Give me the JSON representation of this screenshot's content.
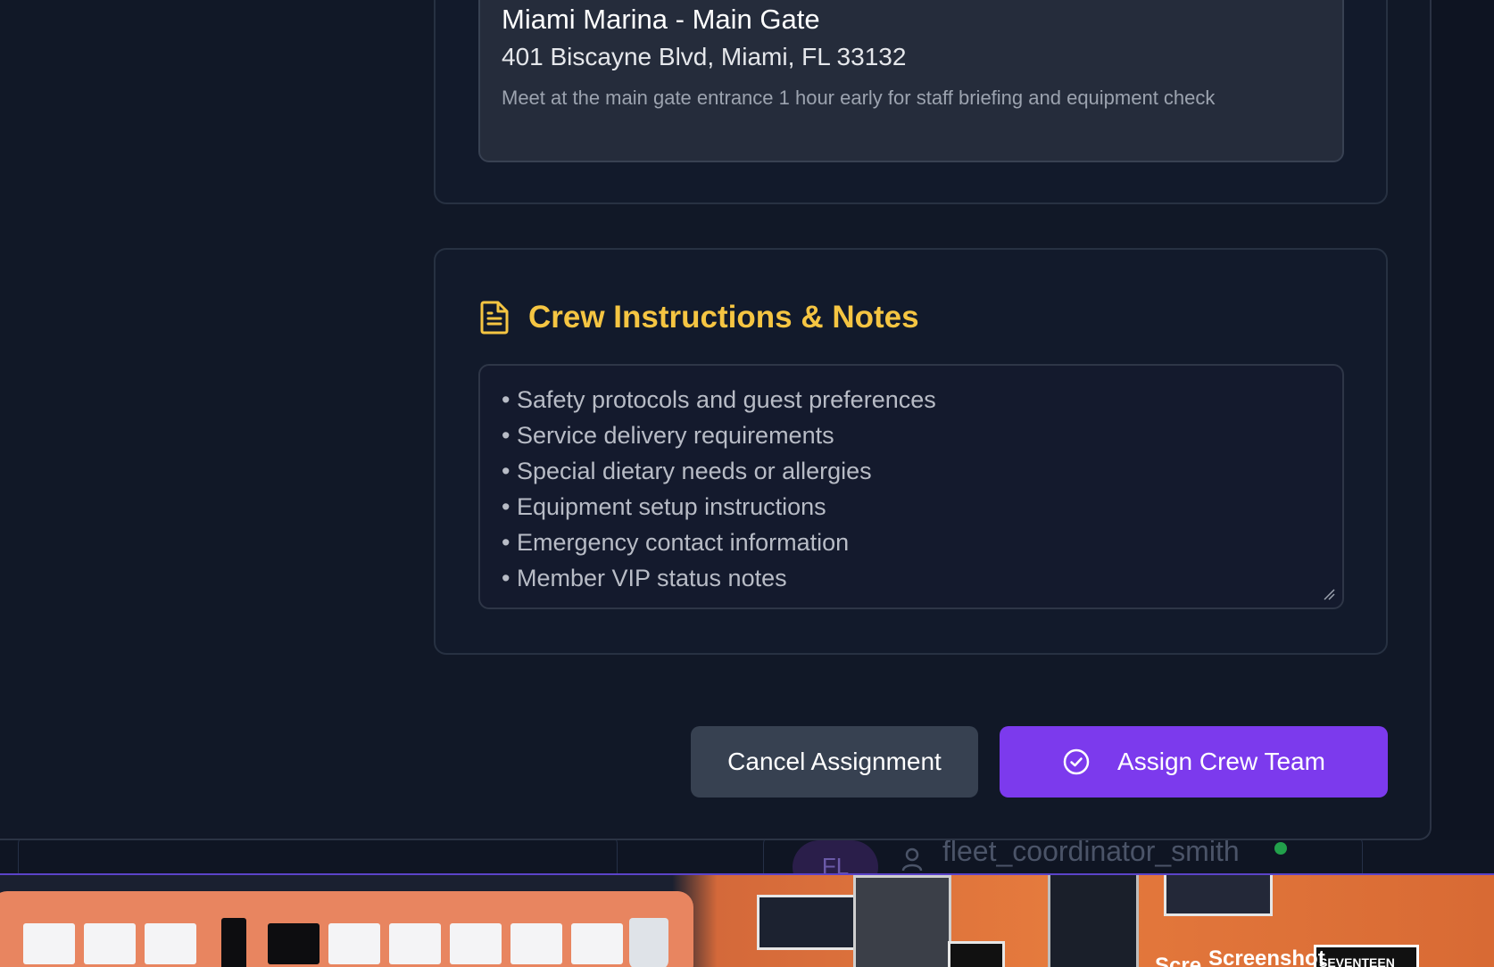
{
  "location": {
    "name": "Miami Marina - Main Gate",
    "address": "401 Biscayne Blvd, Miami, FL 33132",
    "note": "Meet at the main gate entrance 1 hour early for staff briefing and equipment check"
  },
  "notes": {
    "icon": "document-icon",
    "title": "Crew Instructions & Notes",
    "lines": [
      "• Safety protocols and guest preferences",
      "• Service delivery requirements",
      "• Special dietary needs or allergies",
      "• Equipment setup instructions",
      "• Emergency contact information",
      "• Member VIP status notes"
    ]
  },
  "actions": {
    "cancel_label": "Cancel Assignment",
    "assign_label": "Assign Crew Team",
    "assign_icon": "check-circle-icon"
  },
  "background": {
    "avatar_initials": "FL",
    "username": "fleet_coordinator_smith"
  },
  "desktop": {
    "label_1": "Screenshot",
    "label_2": "Scre",
    "label_3": "SEVENTEEN"
  },
  "colors": {
    "accent": "#7c3aed",
    "heading": "#f5c542",
    "online": "#22a04b"
  }
}
